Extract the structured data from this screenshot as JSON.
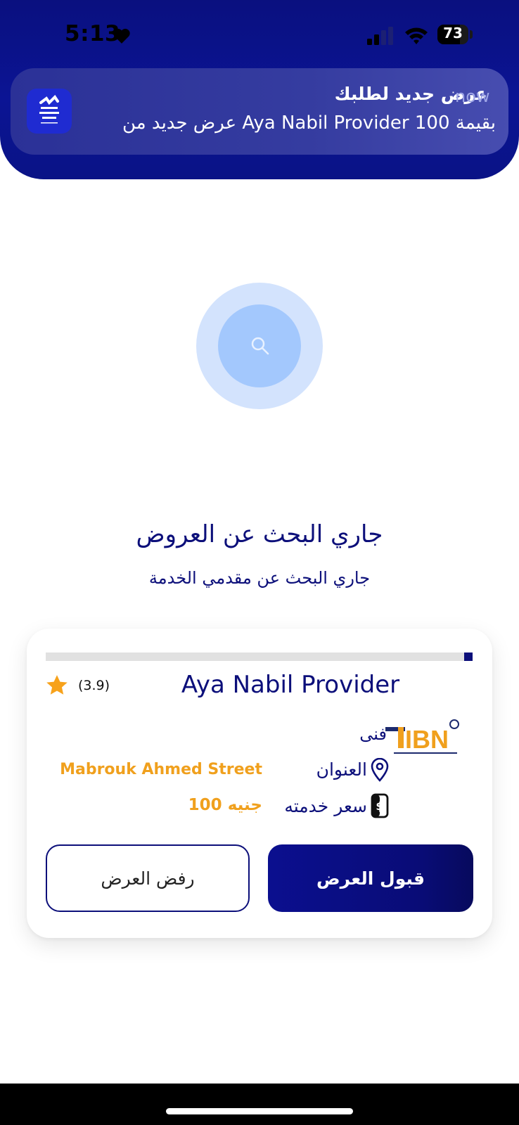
{
  "status_bar": {
    "time": "5:13",
    "battery_percent": "73",
    "battery_level": 0.73
  },
  "notification": {
    "title": "عرض جديد لطلبك",
    "time": "now",
    "body": "عرض جديد من Aya Nabil Provider بقيمة 100"
  },
  "search": {
    "title": "جاري البحث عن العروض",
    "subtitle": "جاري البحث عن مقدمي الخدمة"
  },
  "offer": {
    "progress": 0.02,
    "provider_name": "Aya Nabil Provider",
    "rating": "(3.9)",
    "role": "فنى",
    "address_label": "العنوان",
    "address_value": "Mabrouk Ahmed Street",
    "price_label": "سعر خدمته",
    "price_value": "100 جنيه",
    "accept_label": "قبول العرض",
    "reject_label": "رفض العرض",
    "logo_text": "IBN"
  },
  "colors": {
    "primary": "#0c0f7a",
    "accent": "#f0a01d",
    "search_outer": "#d3e3fd",
    "search_inner": "#a3c8fd"
  }
}
